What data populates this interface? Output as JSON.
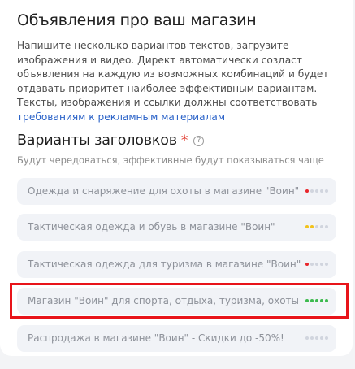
{
  "ads_section": {
    "title": "Объявления про ваш магазин",
    "description_text": "Напишите несколько вариантов текстов, загрузите изображения и видео. Директ автоматически создаст объявления на каждую из возможных комбинаций и будет отдавать приоритет наиболее эффективным вариантам. Тексты, изображения и ссылки должны соответствовать ",
    "description_link": "требованиям к рекламным материалам"
  },
  "headlines": {
    "title": "Варианты заголовков",
    "required_mark": "*",
    "help_icon": "?",
    "subtitle": "Будут чередоваться, эффективные будут показываться чаще",
    "items": [
      {
        "text": "Одежда и снаряжение для охоты в магазине \"Воин\"",
        "rating": 1,
        "rating_color": "#e8262b"
      },
      {
        "text": "Тактическая одежда и обувь в магазине \"Воин\"",
        "rating": 2,
        "rating_color": "#f2c21b"
      },
      {
        "text": "Тактическая одежда для туризма в магазине \"Воин\"",
        "rating": 1,
        "rating_color": "#e8262b"
      },
      {
        "text": "Магазин \"Воин\" для спорта, отдыха, туризма, охоты",
        "rating": 5,
        "rating_color": "#3cba4e"
      },
      {
        "text": "Распродажа в магазине \"Воин\" - Скидки до -50%!",
        "rating": 0,
        "rating_color": "#d1d5de"
      }
    ]
  },
  "highlight_color": "#e8141a"
}
